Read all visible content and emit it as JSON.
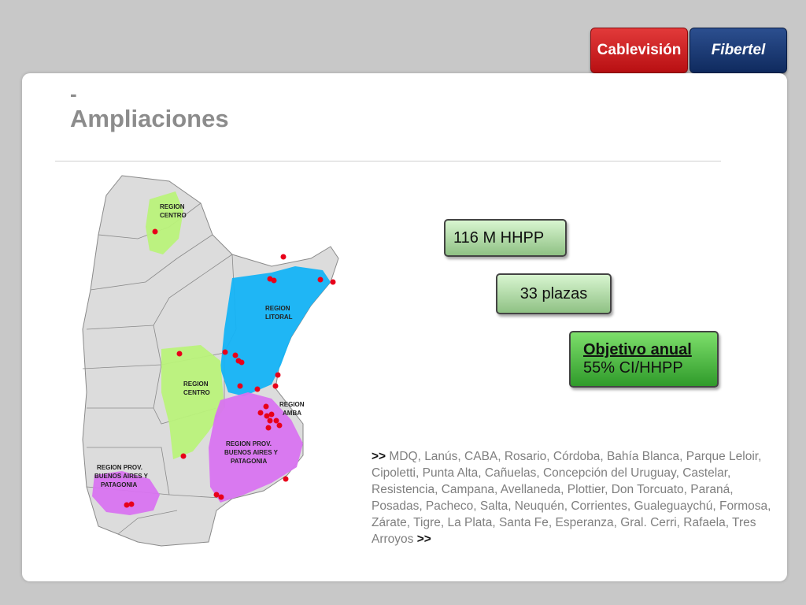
{
  "logos": {
    "cablevision": "Cablevisión",
    "fibertel": "Fibertel"
  },
  "slide": {
    "dash": "-",
    "title": "Ampliaciones"
  },
  "map": {
    "labels": {
      "centro_north_1": "REGION",
      "centro_north_2": "CENTRO",
      "litoral_1": "REGION",
      "litoral_2": "LITORAL",
      "centro_1": "REGION",
      "centro_2": "CENTRO",
      "amba_1": "REGION",
      "amba_2": "AMBA",
      "bsas_1": "REGION  PROV.",
      "bsas_2": "BUENOS AIRES Y",
      "bsas_3": "PATAGONIA",
      "bsas_west_1": "REGION PROV.",
      "bsas_west_2": "BUENOS AIRES Y",
      "bsas_west_3": "PATAGONIA"
    },
    "colors": {
      "green": "#b9f27a",
      "blue": "#14b3f5",
      "purple": "#d873f0",
      "dot": "#e8001a",
      "province": "#dcdcdc"
    }
  },
  "stats": {
    "hhpp": "116 M HHPP",
    "plazas": "33 plazas",
    "objetivo_title": "Objetivo anual",
    "objetivo_value": "55% CI/HHPP"
  },
  "cities": {
    "arrow_open": ">>",
    "list": " MDQ, Lanús, CABA, Rosario, Córdoba, Bahía Blanca, Parque Leloir, Cipoletti, Punta Alta, Cañuelas, Concepción del Uruguay, Castelar, Resistencia, Campana, Avellaneda, Plottier, Don Torcuato, Paraná, Posadas, Pacheco, Salta, Neuquén, Corrientes, Gualeguaychú, Formosa, Zárate, Tigre, La Plata, Santa Fe, Esperanza, Gral. Cerri, Rafaela, Tres Arroyos ",
    "arrow_close": ">>"
  }
}
